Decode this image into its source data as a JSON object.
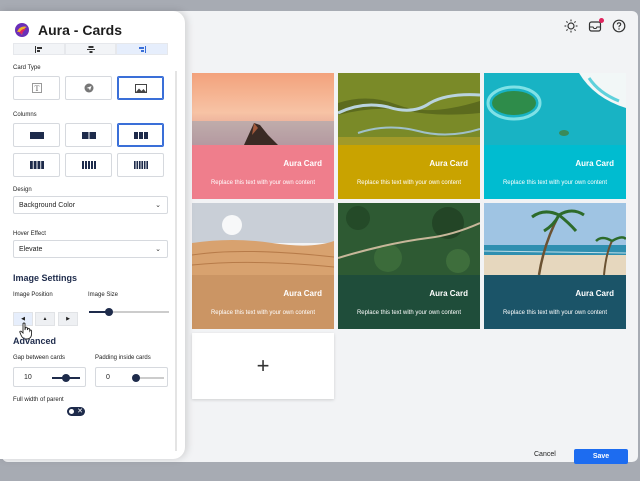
{
  "panel": {
    "title": "Aura - Cards",
    "card_type_label": "Card Type",
    "columns_label": "Columns",
    "design_label": "Design",
    "design_value": "Background Color",
    "hover_label": "Hover Effect",
    "hover_value": "Elevate",
    "image_settings_title": "Image Settings",
    "image_position_label": "Image Position",
    "image_size_label": "Image Size",
    "image_size_value": 0.25,
    "advanced_title": "Advanced",
    "gap_label": "Gap between cards",
    "gap_value": "10",
    "padding_label": "Padding inside cards",
    "padding_value": "0",
    "full_width_label": "Full width of parent",
    "full_width_on": true
  },
  "cards": [
    {
      "title": "Aura Card",
      "text": "Replace this text with your own content",
      "color": "#ef7e8c",
      "image": "sunset-mountain"
    },
    {
      "title": "Aura Card",
      "text": "Replace this text with your own content",
      "color": "#c9a300",
      "image": "river-aerial"
    },
    {
      "title": "Aura Card",
      "text": "Replace this text with your own content",
      "color": "#00bcd0",
      "image": "island-aerial"
    },
    {
      "title": "Aura Card",
      "text": "Replace this text with your own content",
      "color": "#cb9564",
      "image": "desert-dunes"
    },
    {
      "title": "Aura Card",
      "text": "Replace this text with your own content",
      "color": "#1f4d3a",
      "image": "forest-road"
    },
    {
      "title": "Aura Card",
      "text": "Replace this text with your own content",
      "color": "#1b5468",
      "image": "beach-palms"
    }
  ],
  "add_card": {
    "icon": "plus-icon"
  },
  "footer": {
    "cancel_label": "Cancel",
    "save_label": "Save"
  },
  "colors": {
    "accent": "#1d6cf0",
    "dark": "#1e2b4b",
    "notification": "#e0245e"
  }
}
